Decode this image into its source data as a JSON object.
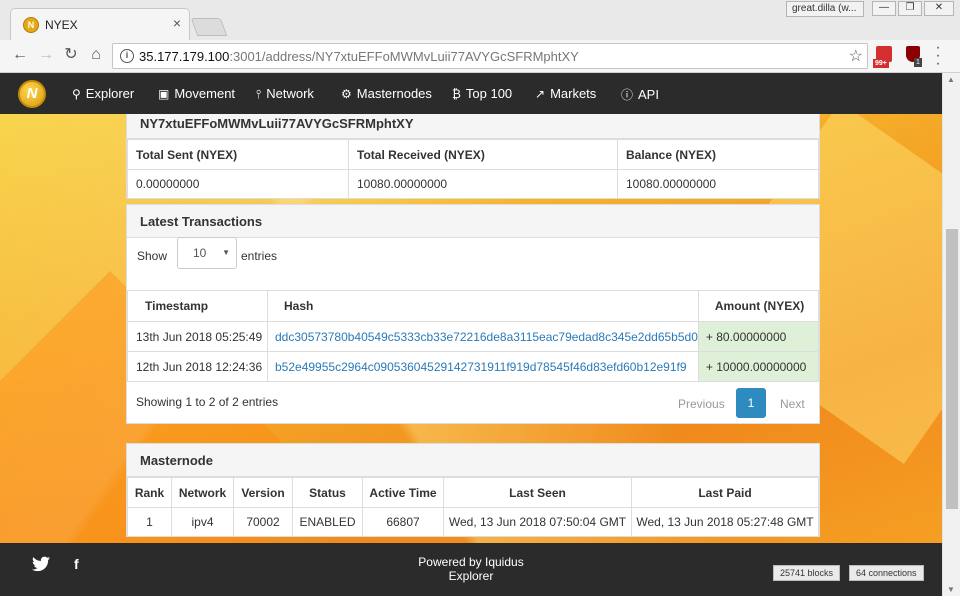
{
  "browser": {
    "tab_title": "NYEX",
    "tab_close": "×",
    "profile": "great.dilla (w...",
    "win_minimize": "—",
    "win_restore": "❐",
    "win_close": "✕",
    "url_host": "35.177.179.100",
    "url_rest": ":3001/address/NY7xtuEFFoMWMvLuii77AVYGcSFRMphtXY",
    "ext1_badge": "99+",
    "ext2_badge": "1"
  },
  "navbar": {
    "brand": "N",
    "items": [
      {
        "label": "Explorer",
        "icon": "search-icon"
      },
      {
        "label": "Movement",
        "icon": "money-icon"
      },
      {
        "label": "Network",
        "icon": "share-icon"
      },
      {
        "label": "Masternodes",
        "icon": "masternode-icon"
      },
      {
        "label": "Top 100",
        "icon": "bitcoin-icon"
      },
      {
        "label": "Markets",
        "icon": "line-chart-icon"
      },
      {
        "label": "API",
        "icon": "info-icon"
      }
    ]
  },
  "address_panel": {
    "address": "NY7xtuEFFoMWMvLuii77AVYGcSFRMphtXY",
    "headers": [
      "Total Sent (NYEX)",
      "Total Received (NYEX)",
      "Balance (NYEX)"
    ],
    "values": [
      "0.00000000",
      "10080.00000000",
      "10080.00000000"
    ]
  },
  "transactions": {
    "title": "Latest Transactions",
    "show_label": "Show",
    "page_length": "10",
    "entries_label": "entries",
    "headers": [
      "Timestamp",
      "Hash",
      "Amount (NYEX)"
    ],
    "rows": [
      {
        "timestamp": "13th Jun 2018 05:25:49",
        "hash": "ddc30573780b40549c5333cb33e72216de8a3115eac79edad8c345e2dd65b5d0",
        "amount": "+ 80.00000000"
      },
      {
        "timestamp": "12th Jun 2018 12:24:36",
        "hash": "b52e49955c2964c09053604529142731911f919d78545f46d83efd60b12e91f9",
        "amount": "+ 10000.00000000"
      }
    ],
    "info": "Showing 1 to 2 of 2 entries",
    "previous": "Previous",
    "current_page": "1",
    "next": "Next"
  },
  "masternode": {
    "title": "Masternode",
    "headers": [
      "Rank",
      "Network",
      "Version",
      "Status",
      "Active Time",
      "Last Seen",
      "Last Paid"
    ],
    "row": [
      "1",
      "ipv4",
      "70002",
      "ENABLED",
      "66807",
      "Wed, 13 Jun 2018 07:50:04 GMT",
      "Wed, 13 Jun 2018 05:27:48 GMT"
    ]
  },
  "footer": {
    "powered_line1": "Powered by Iquidus",
    "powered_line2": "Explorer",
    "blocks": "25741 blocks",
    "connections": "64 connections"
  }
}
